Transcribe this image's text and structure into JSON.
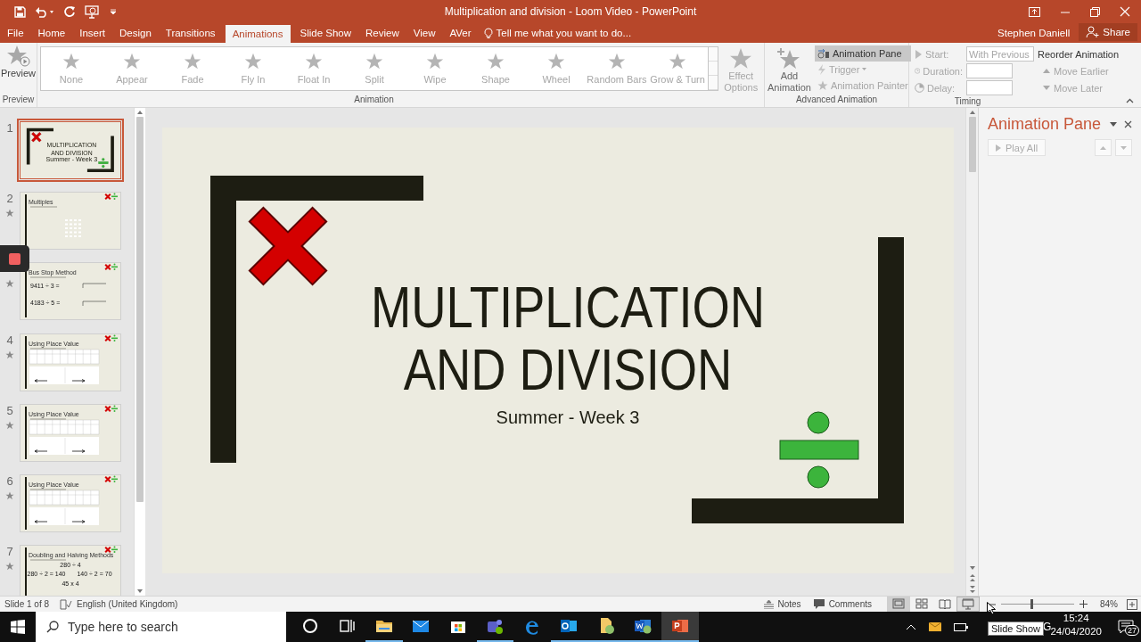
{
  "window": {
    "title": "Multiplication and division - Loom Video - PowerPoint",
    "user": "Stephen Daniell",
    "share": "Share"
  },
  "tabs": [
    {
      "label": "File",
      "selected": false
    },
    {
      "label": "Home",
      "selected": false
    },
    {
      "label": "Insert",
      "selected": false
    },
    {
      "label": "Design",
      "selected": false
    },
    {
      "label": "Transitions",
      "selected": false
    },
    {
      "label": "Animations",
      "selected": true
    },
    {
      "label": "Slide Show",
      "selected": false
    },
    {
      "label": "Review",
      "selected": false
    },
    {
      "label": "View",
      "selected": false
    },
    {
      "label": "AVer",
      "selected": false
    }
  ],
  "tell_me": "Tell me what you want to do...",
  "ribbon": {
    "preview": {
      "label": "Preview",
      "group": "Preview"
    },
    "animation_gallery": {
      "disabled": true,
      "group": "Animation",
      "options": [
        "None",
        "Appear",
        "Fade",
        "Fly In",
        "Float In",
        "Split",
        "Wipe",
        "Shape",
        "Wheel",
        "Random Bars",
        "Grow & Turn"
      ]
    },
    "effect_options": {
      "label": "Effect Options",
      "disabled": true
    },
    "advanced": {
      "group": "Advanced Animation",
      "add_animation": "Add Animation",
      "animation_pane": {
        "label": "Animation Pane",
        "selected": true
      },
      "trigger": {
        "label": "Trigger",
        "disabled": true
      },
      "painter": {
        "label": "Animation Painter",
        "disabled": true
      }
    },
    "timing": {
      "group": "Timing",
      "start": {
        "label": "Start:",
        "value": "With Previous",
        "disabled": true
      },
      "duration": {
        "label": "Duration:",
        "disabled": true
      },
      "delay": {
        "label": "Delay:",
        "disabled": true
      },
      "reorder": "Reorder Animation",
      "move_earlier": {
        "label": "Move Earlier",
        "disabled": true
      },
      "move_later": {
        "label": "Move Later",
        "disabled": true
      }
    }
  },
  "slides": [
    {
      "number": "1",
      "selected": true,
      "animated": false,
      "kind": "title",
      "title_lines": [
        "MULTIPLICATION",
        "AND DIVISION"
      ],
      "subtitle": "Summer - Week 3"
    },
    {
      "number": "2",
      "selected": false,
      "animated": true,
      "kind": "grid",
      "title": "Multiples"
    },
    {
      "selected": false,
      "animated": true,
      "kind": "division",
      "title": "Bus Stop Method",
      "lines": [
        "9411 ÷ 3 =",
        "4183 ÷ 5 ="
      ]
    },
    {
      "number": "4",
      "selected": false,
      "animated": true,
      "kind": "table",
      "title": "Using Place Value"
    },
    {
      "number": "5",
      "selected": false,
      "animated": true,
      "kind": "table",
      "title": "Using Place Value"
    },
    {
      "number": "6",
      "selected": false,
      "animated": true,
      "kind": "table",
      "title": "Using Place Value"
    },
    {
      "number": "7",
      "selected": false,
      "animated": true,
      "kind": "doubling",
      "title": "Doubling and Halving Methods",
      "lines": [
        "280 ÷ 4",
        "280 ÷ 2 = 140",
        "140 ÷ 2 = 70",
        "45 x 4"
      ]
    }
  ],
  "slide": {
    "title_lines": [
      "MULTIPLICATION",
      "AND DIVISION"
    ],
    "subtitle": "Summer - Week 3"
  },
  "animation_pane": {
    "title": "Animation Pane",
    "play_all": "Play All"
  },
  "status_bar": {
    "slide": "Slide 1 of 8",
    "language": "English (United Kingdom)",
    "notes": "Notes",
    "comments": "Comments",
    "zoom": "84%",
    "level": 0.42,
    "views": [
      {
        "kind": "normal",
        "selected": true,
        "hovered": false
      },
      {
        "kind": "sorter",
        "selected": false,
        "hovered": false
      },
      {
        "kind": "reading",
        "selected": false,
        "hovered": false
      },
      {
        "kind": "slideshow",
        "selected": false,
        "hovered": true
      }
    ]
  },
  "taskbar": {
    "search_placeholder": "Type here to search",
    "apps": [
      {
        "kind": "cortana",
        "running": false,
        "selected": false
      },
      {
        "kind": "taskview",
        "running": false,
        "selected": false
      },
      {
        "kind": "explorer",
        "running": true,
        "selected": false
      },
      {
        "kind": "mail",
        "running": false,
        "selected": false
      },
      {
        "kind": "store",
        "running": false,
        "selected": false
      },
      {
        "kind": "teams",
        "running": true,
        "selected": false
      },
      {
        "kind": "edge",
        "running": false,
        "selected": false
      },
      {
        "kind": "outlook",
        "running": true,
        "selected": false
      },
      {
        "kind": "remote",
        "running": true,
        "selected": false
      },
      {
        "kind": "word",
        "running": true,
        "selected": false
      },
      {
        "kind": "powerpoint",
        "running": true,
        "selected": true
      }
    ],
    "tooltip": "Slide Show",
    "language_fragment": "G",
    "time": "15:24",
    "date": "24/04/2020",
    "notification_count": "27"
  }
}
